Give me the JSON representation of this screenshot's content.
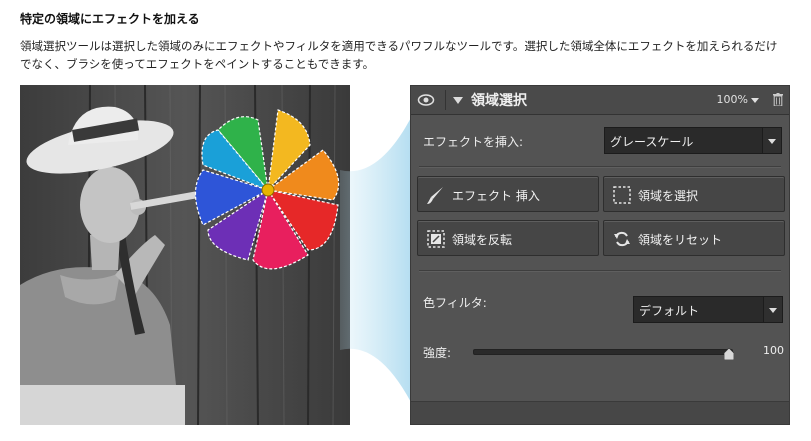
{
  "heading": "特定の領域にエフェクトを加える",
  "description": {
    "line1": "領域選択ツールは選択した領域のみにエフェクトやフィルタを適用できるパワフルなツールです。選択した領域全体にエフェクトを加えられるだけ",
    "line2": "でなく、ブラシを使ってエフェクトをペイントすることもできます。"
  },
  "panel": {
    "title": "領域選択",
    "zoom": "100%",
    "effect_label": "エフェクトを挿入:",
    "effect_value": "グレースケール",
    "buttons": {
      "insert_effect": "エフェクト 挿入",
      "select_area": "領域を選択",
      "invert_area": "領域を反転",
      "reset_area": "領域をリセット"
    },
    "filter_label": "色フィルタ:",
    "filter_value": "デフォルト",
    "strength_label": "強度:",
    "strength_value": "100"
  },
  "icons": {
    "visibility": "eye-icon",
    "collapse": "triangle-down-icon",
    "zoom_menu": "chevron-down-icon",
    "delete": "trash-icon",
    "insert_effect": "brush-icon",
    "select_area": "dashed-square-icon",
    "invert_area": "invert-selection-icon",
    "reset_area": "reset-arrows-icon"
  }
}
